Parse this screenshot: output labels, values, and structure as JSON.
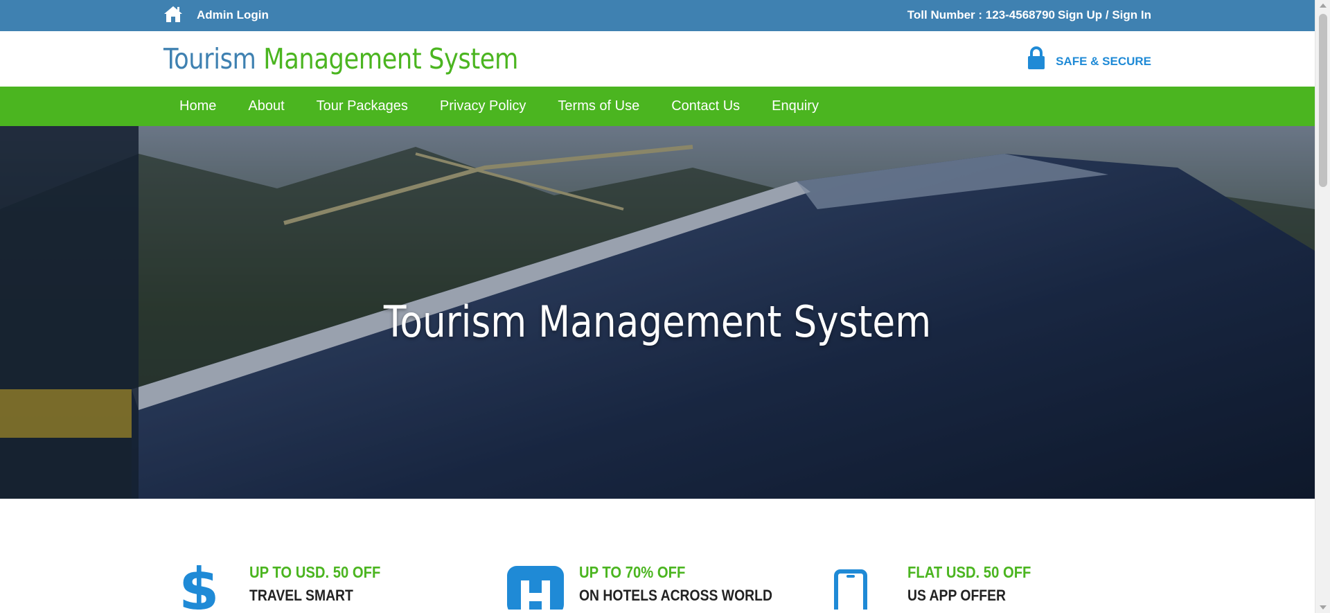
{
  "topbar": {
    "home_icon": "home-icon",
    "admin_login": "Admin Login",
    "toll_number": "Toll Number : 123-4568790",
    "sign_up_in": "Sign Up / Sign In"
  },
  "header": {
    "logo_part1": "Tourism",
    "logo_part2": "Management System",
    "secure_icon": "lock-icon",
    "secure_label": "SAFE & SECURE"
  },
  "nav": {
    "items": [
      {
        "label": "Home"
      },
      {
        "label": "About"
      },
      {
        "label": "Tour Packages"
      },
      {
        "label": "Privacy Policy"
      },
      {
        "label": "Terms of Use"
      },
      {
        "label": "Contact Us"
      },
      {
        "label": "Enquiry"
      }
    ]
  },
  "hero": {
    "title": "Tourism Management System"
  },
  "offers": [
    {
      "icon": "dollar-icon",
      "title": "UP TO USD. 50 OFF",
      "subtitle": "TRAVEL SMART"
    },
    {
      "icon": "hotel-icon",
      "title": "UP TO 70% OFF",
      "subtitle": "ON HOTELS ACROSS WORLD"
    },
    {
      "icon": "mobile-phone-icon",
      "title": "FLAT USD. 50 OFF",
      "subtitle": "US APP OFFER"
    }
  ],
  "colors": {
    "topbar_blue": "#3f81b1",
    "nav_green": "#4bb520",
    "accent_blue": "#1f8ad6"
  }
}
